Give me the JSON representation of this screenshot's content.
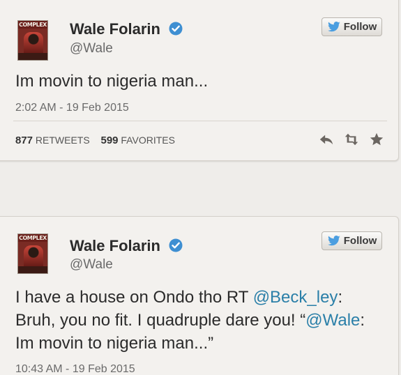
{
  "tweets": [
    {
      "author_name": "Wale Folarin",
      "handle": "@Wale",
      "avatar_text": "COMPLEX",
      "follow_label": "Follow",
      "text": "Im movin to nigeria man...",
      "timestamp": "2:02 AM - 19 Feb 2015",
      "retweets_count": "877",
      "retweets_label": "RETWEETS",
      "favorites_count": "599",
      "favorites_label": "FAVORITES"
    },
    {
      "author_name": "Wale Folarin",
      "handle": "@Wale",
      "avatar_text": "COMPLEX",
      "follow_label": "Follow",
      "text_line1_a": "I have a house on Ondo tho RT ",
      "text_line1_mention": "@Beck_ley",
      "text_line1_b": ":",
      "text_line2_a": "Bruh, you no fit. I quadruple dare you! “",
      "text_line2_mention": "@Wale",
      "text_line2_b": ":",
      "text_line3": "Im movin to nigeria man...”",
      "timestamp": "10:43 AM - 19 Feb 2015"
    }
  ],
  "icons": {
    "verified": "verified-badge-icon",
    "bird": "twitter-bird-icon",
    "reply": "reply-icon",
    "retweet": "retweet-icon",
    "favorite": "star-icon"
  },
  "colors": {
    "mention": "#2a7fa8",
    "verified": "#3e8fd2",
    "bird": "#4b9ee0"
  }
}
